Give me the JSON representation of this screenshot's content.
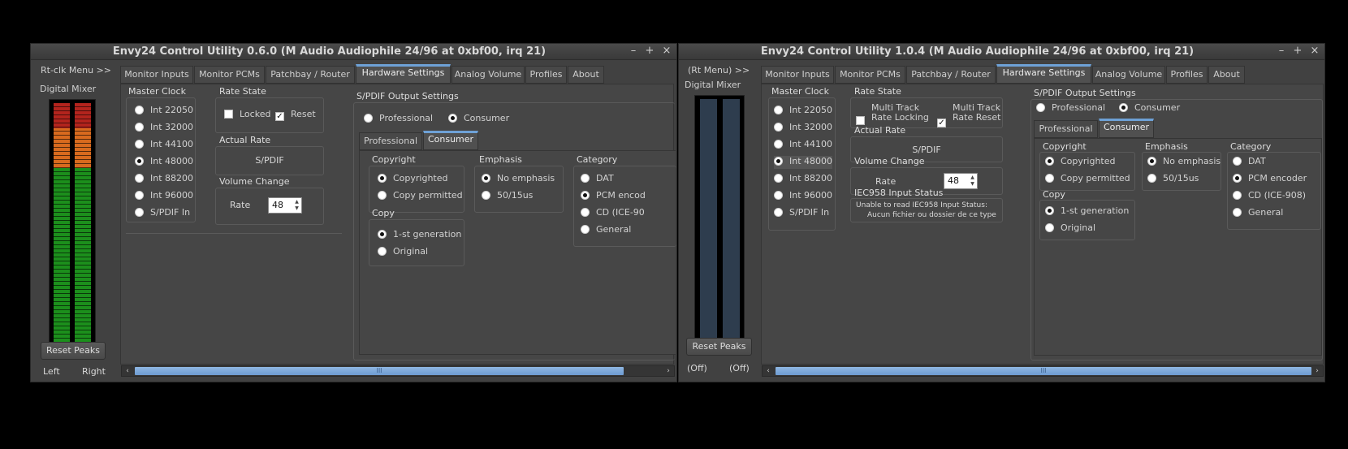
{
  "w1": {
    "title": "Envy24 Control Utility 0.6.0 (M Audio Audiophile 24/96 at 0xbf00, irq 21)",
    "controls": [
      "–",
      "+",
      "×"
    ],
    "menu": "Rt-clk Menu >>",
    "mixer_label": "Digital Mixer",
    "left": "Left",
    "right": "Right",
    "reset": "Reset Peaks",
    "tabs": [
      "Monitor Inputs",
      "Monitor PCMs",
      "Patchbay / Router",
      "Hardware Settings",
      "Analog Volume",
      "Profiles",
      "About"
    ],
    "master_clock": "Master Clock",
    "clocks": [
      "Int 22050",
      "Int 32000",
      "Int 44100",
      "Int 48000",
      "Int 88200",
      "Int 96000",
      "S/PDIF In"
    ],
    "selected_clock": "Int 48000",
    "rate_state": "Rate State",
    "locked": "Locked",
    "reset_chk": "Reset",
    "actual_rate": "Actual Rate",
    "actual_rate_value": "S/PDIF",
    "volume_change": "Volume Change",
    "rate": "Rate",
    "rate_value": "48",
    "spdif_title": "S/PDIF Output Settings",
    "professional": "Professional",
    "consumer": "Consumer",
    "subtabs": [
      "Professional",
      "Consumer"
    ],
    "copyright": "Copyright",
    "copyrighted": "Copyrighted",
    "copy_permitted": "Copy permitted",
    "copy": "Copy",
    "first_gen": "1-st generation",
    "original": "Original",
    "emphasis": "Emphasis",
    "no_emphasis": "No emphasis",
    "emph_5015": "50/15us",
    "category": "Category",
    "cats": [
      "DAT",
      "PCM encod",
      "CD (ICE-90",
      "General"
    ]
  },
  "w2": {
    "title": "Envy24 Control Utility 1.0.4 (M Audio Audiophile 24/96 at 0xbf00, irq 21)",
    "controls": [
      "–",
      "+",
      "×"
    ],
    "menu": "(Rt Menu) >>",
    "mixer_label": "Digital Mixer",
    "off_left": "(Off)",
    "off_right": "(Off)",
    "reset": "Reset Peaks",
    "tabs": [
      "Monitor Inputs",
      "Monitor PCMs",
      "Patchbay / Router",
      "Hardware Settings",
      "Analog Volume",
      "Profiles",
      "About"
    ],
    "master_clock": "Master Clock",
    "clocks": [
      "Int 22050",
      "Int 32000",
      "Int 44100",
      "Int 48000",
      "Int 88200",
      "Int 96000",
      "S/PDIF In"
    ],
    "rate_state": "Rate State",
    "mt_lock_1": "Multi Track",
    "mt_lock_2": "Rate Locking",
    "mt_reset_1": "Multi Track",
    "mt_reset_2": "Rate Reset",
    "actual_rate": "Actual Rate",
    "actual_rate_value": "S/PDIF",
    "volume_change": "Volume Change",
    "rate": "Rate",
    "rate_value": "48",
    "iec_title": "IEC958 Input Status",
    "iec_line1": "Unable to read IEC958 Input Status:",
    "iec_line2": "Aucun fichier ou dossier de ce type",
    "spdif_title": "S/PDIF Output Settings",
    "professional": "Professional",
    "consumer": "Consumer",
    "subtabs": [
      "Professional",
      "Consumer"
    ],
    "copyright": "Copyright",
    "copyrighted": "Copyrighted",
    "copy_permitted": "Copy permitted",
    "copy": "Copy",
    "first_gen": "1-st generation",
    "original": "Original",
    "emphasis": "Emphasis",
    "no_emphasis": "No emphasis",
    "emph_5015": "50/15us",
    "category": "Category",
    "cats": [
      "DAT",
      "PCM encoder",
      "CD (ICE-908)",
      "General"
    ]
  },
  "scroll_glyph": "III",
  "arrow_left": "‹",
  "arrow_right": "›",
  "colors": {
    "accent": "#6ea1d6",
    "vu_red": "#b3241d",
    "vu_orange": "#d86a1e",
    "vu_green": "#1c8f1c",
    "vu_dark": "#2e3d4e"
  }
}
